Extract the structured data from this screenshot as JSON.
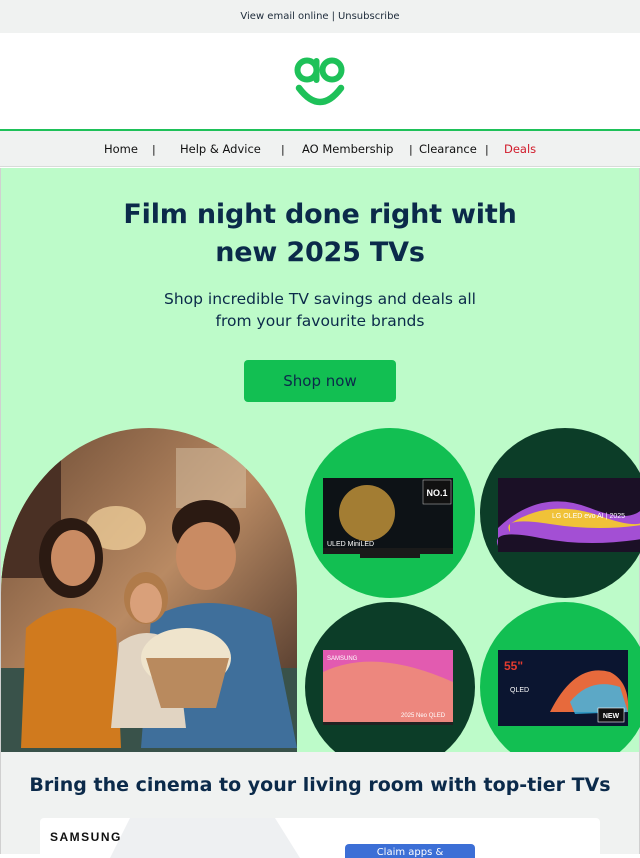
{
  "topbar": {
    "view_online": "View email online",
    "separator": "|",
    "unsubscribe": "Unsubscribe"
  },
  "logo": {
    "icon": "ao-smile-logo",
    "color": "#1ec159"
  },
  "nav": {
    "items": [
      "Home",
      "Help & Advice",
      "AO Membership",
      "Clearance",
      "Deals"
    ],
    "separator": "|",
    "deals_color": "#d11a2a"
  },
  "hero": {
    "headline_line1": "Film night done right with",
    "headline_line2": "new 2025 TVs",
    "subline_line1": "Shop incredible TV savings and deals all",
    "subline_line2": "from your favourite brands",
    "cta": "Shop now",
    "background": "#bdfbc9",
    "accent": "#12bf52",
    "tv_hisense": {
      "badge": "NO.1",
      "label": "ULED MiniLED"
    },
    "tv_lg": {
      "label": "LG OLED evo AI | 2025"
    },
    "tv_samsung": {
      "brand": "SAMSUNG",
      "label": "2025 Neo QLED"
    },
    "tv_tcl": {
      "size": "55\"",
      "panel": "QLED",
      "badge": "NEW"
    }
  },
  "section2": {
    "title": "Bring the cinema to your living room with top-tier TVs",
    "card_brand": "SAMSUNG",
    "card_button": "Claim apps &"
  }
}
